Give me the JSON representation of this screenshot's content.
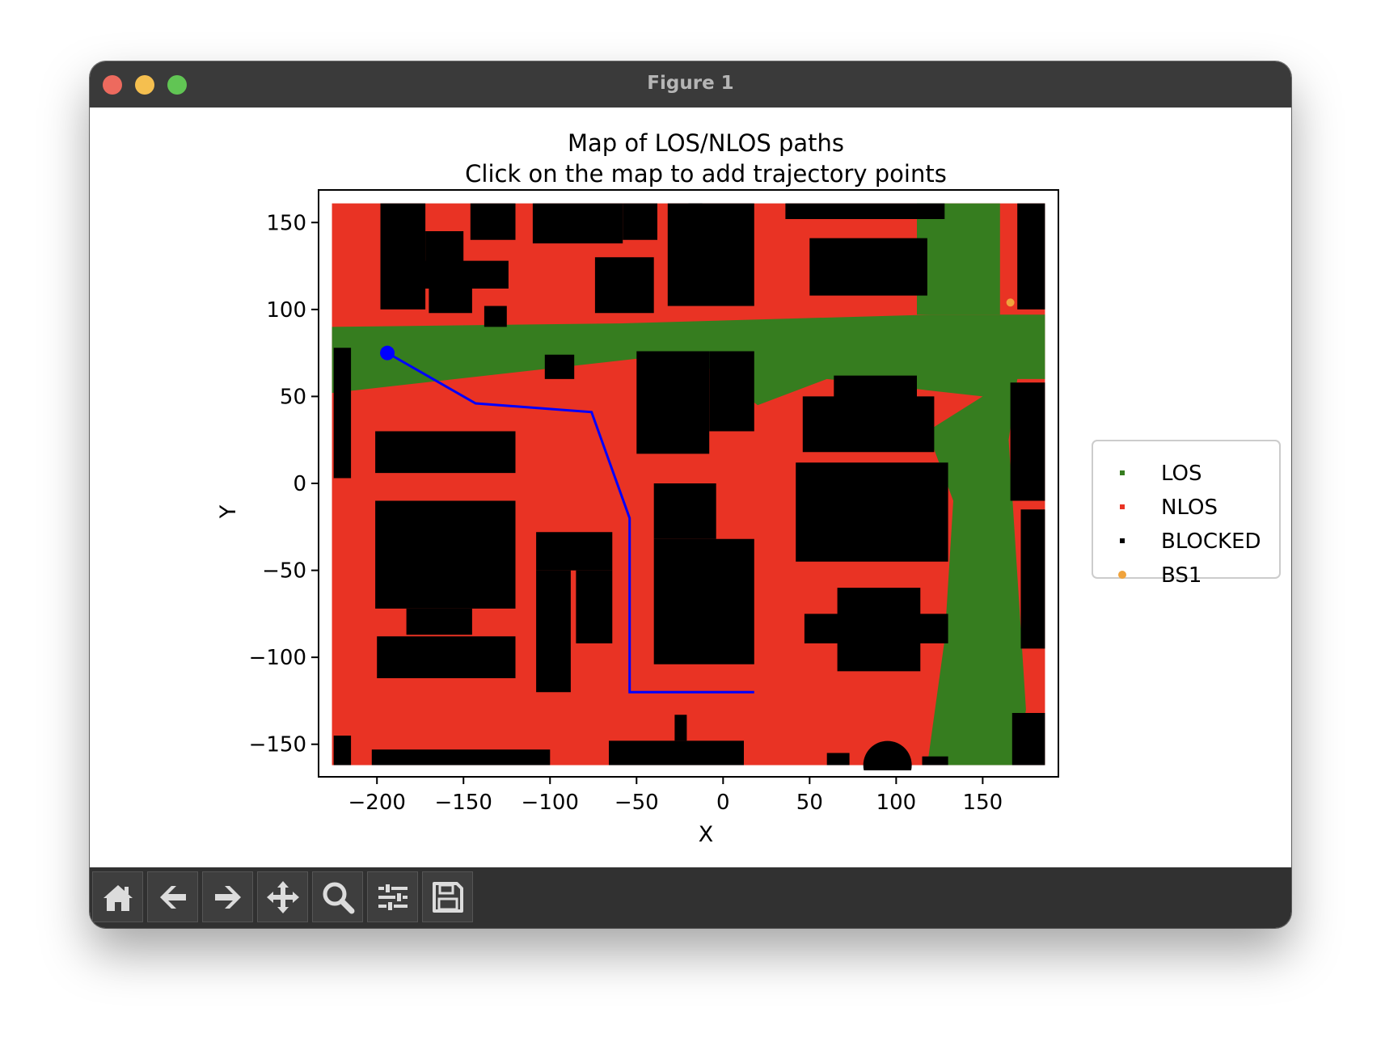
{
  "window": {
    "title": "Figure 1"
  },
  "figure": {
    "title_line1": "Map of LOS/NLOS paths",
    "title_line2": "Click on the map to add trajectory points"
  },
  "colors": {
    "los": "#367d1f",
    "nlos": "#e93324",
    "blocked": "#000000",
    "bs": "#f0a33c",
    "trajectory": "#0000ff"
  },
  "chart_data": {
    "type": "scatter",
    "title": "Map of LOS/NLOS paths\nClick on the map to add trajectory points",
    "xlabel": "X",
    "ylabel": "Y",
    "xlim": [
      -230,
      190
    ],
    "ylim": [
      -165,
      165
    ],
    "xticks": [
      "−200",
      "−150",
      "−100",
      "−50",
      "0",
      "50",
      "100",
      "150"
    ],
    "xtick_values": [
      -200,
      -150,
      -100,
      -50,
      0,
      50,
      100,
      150
    ],
    "yticks": [
      "150",
      "100",
      "50",
      "0",
      "−50",
      "−100",
      "−150"
    ],
    "ytick_values": [
      150,
      100,
      50,
      0,
      -50,
      -100,
      -150
    ],
    "legend": {
      "position": "outside-right",
      "entries": [
        {
          "label": "LOS",
          "color": "#367d1f"
        },
        {
          "label": "NLOS",
          "color": "#e93324"
        },
        {
          "label": "BLOCKED",
          "color": "#000000"
        },
        {
          "label": "BS1",
          "color": "#f0a33c"
        }
      ]
    },
    "base_station": {
      "name": "BS1",
      "x": 166,
      "y": 104
    },
    "trajectory": [
      [
        -194,
        75
      ],
      [
        -143,
        46
      ],
      [
        -76,
        41
      ],
      [
        -54,
        -20
      ],
      [
        -54,
        -120
      ],
      [
        18,
        -120
      ]
    ],
    "trajectory_start": [
      -194,
      75
    ],
    "regions": {
      "nlos_background": [
        [
          -226,
          -162
        ],
        [
          186,
          161
        ]
      ],
      "los": [
        [
          [
            -226,
            90
          ],
          [
            -60,
            92
          ],
          [
            120,
            97
          ],
          [
            186,
            97
          ],
          [
            186,
            60
          ],
          [
            170,
            60
          ],
          [
            165,
            25
          ],
          [
            175,
            -130
          ],
          [
            170,
            -162
          ],
          [
            118,
            -162
          ],
          [
            128,
            -90
          ],
          [
            133,
            -10
          ],
          [
            118,
            30
          ],
          [
            150,
            50
          ],
          [
            60,
            60
          ],
          [
            20,
            45
          ],
          [
            -20,
            75
          ],
          [
            -226,
            52
          ]
        ],
        [
          [
            112,
            161
          ],
          [
            160,
            161
          ],
          [
            160,
            97
          ],
          [
            112,
            97
          ]
        ]
      ],
      "blocked": [
        [
          [
            -198,
            161
          ],
          [
            -172,
            161
          ],
          [
            -172,
            100
          ],
          [
            -198,
            100
          ]
        ],
        [
          [
            -172,
            145
          ],
          [
            -150,
            145
          ],
          [
            -150,
            125
          ],
          [
            -172,
            125
          ]
        ],
        [
          [
            -175,
            128
          ],
          [
            -124,
            128
          ],
          [
            -124,
            112
          ],
          [
            -175,
            112
          ]
        ],
        [
          [
            -170,
            112
          ],
          [
            -145,
            112
          ],
          [
            -145,
            98
          ],
          [
            -170,
            98
          ]
        ],
        [
          [
            -146,
            161
          ],
          [
            -120,
            161
          ],
          [
            -120,
            140
          ],
          [
            -146,
            140
          ]
        ],
        [
          [
            -138,
            102
          ],
          [
            -125,
            102
          ],
          [
            -125,
            90
          ],
          [
            -138,
            90
          ]
        ],
        [
          [
            -110,
            161
          ],
          [
            -58,
            161
          ],
          [
            -58,
            138
          ],
          [
            -110,
            138
          ]
        ],
        [
          [
            -74,
            130
          ],
          [
            -40,
            130
          ],
          [
            -40,
            98
          ],
          [
            -74,
            98
          ]
        ],
        [
          [
            -58,
            161
          ],
          [
            -38,
            161
          ],
          [
            -38,
            140
          ],
          [
            -58,
            140
          ]
        ],
        [
          [
            -32,
            161
          ],
          [
            18,
            161
          ],
          [
            18,
            102
          ],
          [
            -32,
            102
          ]
        ],
        [
          [
            -20,
            161
          ],
          [
            -12,
            161
          ],
          [
            -12,
            102
          ],
          [
            -20,
            102
          ]
        ],
        [
          [
            36,
            161
          ],
          [
            128,
            161
          ],
          [
            128,
            152
          ],
          [
            36,
            152
          ]
        ],
        [
          [
            50,
            141
          ],
          [
            118,
            141
          ],
          [
            118,
            108
          ],
          [
            50,
            108
          ]
        ],
        [
          [
            -50,
            76
          ],
          [
            -8,
            76
          ],
          [
            -8,
            17
          ],
          [
            -50,
            17
          ]
        ],
        [
          [
            -8,
            76
          ],
          [
            18,
            76
          ],
          [
            18,
            30
          ],
          [
            -8,
            30
          ]
        ],
        [
          [
            -103,
            74
          ],
          [
            -86,
            74
          ],
          [
            -86,
            60
          ],
          [
            -103,
            60
          ]
        ],
        [
          [
            -225,
            78
          ],
          [
            -215,
            78
          ],
          [
            -215,
            3
          ],
          [
            -225,
            3
          ]
        ],
        [
          [
            -201,
            30
          ],
          [
            -120,
            30
          ],
          [
            -120,
            6
          ],
          [
            -201,
            6
          ]
        ],
        [
          [
            -201,
            -10
          ],
          [
            -120,
            -10
          ],
          [
            -120,
            -72
          ],
          [
            -201,
            -72
          ]
        ],
        [
          [
            -183,
            -72
          ],
          [
            -145,
            -72
          ],
          [
            -145,
            -87
          ],
          [
            -183,
            -87
          ]
        ],
        [
          [
            -200,
            -88
          ],
          [
            -120,
            -88
          ],
          [
            -120,
            -112
          ],
          [
            -200,
            -112
          ]
        ],
        [
          [
            -108,
            -28
          ],
          [
            -64,
            -28
          ],
          [
            -64,
            -50
          ],
          [
            -108,
            -50
          ]
        ],
        [
          [
            -108,
            -50
          ],
          [
            -88,
            -50
          ],
          [
            -88,
            -120
          ],
          [
            -108,
            -120
          ]
        ],
        [
          [
            -85,
            -50
          ],
          [
            -64,
            -50
          ],
          [
            -64,
            -92
          ],
          [
            -85,
            -92
          ]
        ],
        [
          [
            -40,
            0
          ],
          [
            -4,
            0
          ],
          [
            -4,
            -32
          ],
          [
            -40,
            -32
          ]
        ],
        [
          [
            -40,
            -32
          ],
          [
            18,
            -32
          ],
          [
            18,
            -104
          ],
          [
            -40,
            -104
          ]
        ],
        [
          [
            42,
            12
          ],
          [
            130,
            12
          ],
          [
            130,
            -45
          ],
          [
            42,
            -45
          ]
        ],
        [
          [
            46,
            50
          ],
          [
            122,
            50
          ],
          [
            122,
            18
          ],
          [
            46,
            18
          ]
        ],
        [
          [
            64,
            62
          ],
          [
            112,
            62
          ],
          [
            112,
            48
          ],
          [
            64,
            48
          ]
        ],
        [
          [
            66,
            -60
          ],
          [
            114,
            -60
          ],
          [
            114,
            -108
          ],
          [
            66,
            -108
          ]
        ],
        [
          [
            47,
            -75
          ],
          [
            130,
            -75
          ],
          [
            130,
            -92
          ],
          [
            47,
            -92
          ]
        ],
        [
          [
            170,
            161
          ],
          [
            186,
            161
          ],
          [
            186,
            100
          ],
          [
            170,
            100
          ]
        ],
        [
          [
            166,
            58
          ],
          [
            186,
            58
          ],
          [
            186,
            -10
          ],
          [
            166,
            -10
          ]
        ],
        [
          [
            172,
            -15
          ],
          [
            186,
            -15
          ],
          [
            186,
            -95
          ],
          [
            172,
            -95
          ]
        ],
        [
          [
            167,
            -132
          ],
          [
            186,
            -132
          ],
          [
            186,
            -162
          ],
          [
            167,
            -162
          ]
        ],
        [
          [
            -66,
            -148
          ],
          [
            12,
            -148
          ],
          [
            12,
            -162
          ],
          [
            -66,
            -162
          ]
        ],
        [
          [
            -28,
            -133
          ],
          [
            -21,
            -133
          ],
          [
            -21,
            -148
          ],
          [
            -28,
            -148
          ]
        ],
        [
          [
            -225,
            -145
          ],
          [
            -215,
            -145
          ],
          [
            -215,
            -162
          ],
          [
            -225,
            -162
          ]
        ],
        [
          [
            -203,
            -153
          ],
          [
            -100,
            -153
          ],
          [
            -100,
            -162
          ],
          [
            -203,
            -162
          ]
        ],
        [
          [
            60,
            -155
          ],
          [
            73,
            -155
          ],
          [
            73,
            -162
          ],
          [
            60,
            -162
          ]
        ],
        [
          [
            115,
            -157
          ],
          [
            130,
            -157
          ],
          [
            130,
            -162
          ],
          [
            115,
            -162
          ]
        ]
      ],
      "blocked_circles": [
        [
          [
            95,
            -162
          ],
          14
        ]
      ]
    }
  },
  "toolbar": {
    "buttons": [
      {
        "name": "home-button",
        "icon": "home-icon"
      },
      {
        "name": "back-button",
        "icon": "arrow-left-icon"
      },
      {
        "name": "forward-button",
        "icon": "arrow-right-icon"
      },
      {
        "name": "pan-button",
        "icon": "move-icon"
      },
      {
        "name": "zoom-button",
        "icon": "magnifier-icon"
      },
      {
        "name": "configure-subplots-button",
        "icon": "sliders-icon"
      },
      {
        "name": "save-button",
        "icon": "floppy-disk-icon"
      }
    ]
  }
}
